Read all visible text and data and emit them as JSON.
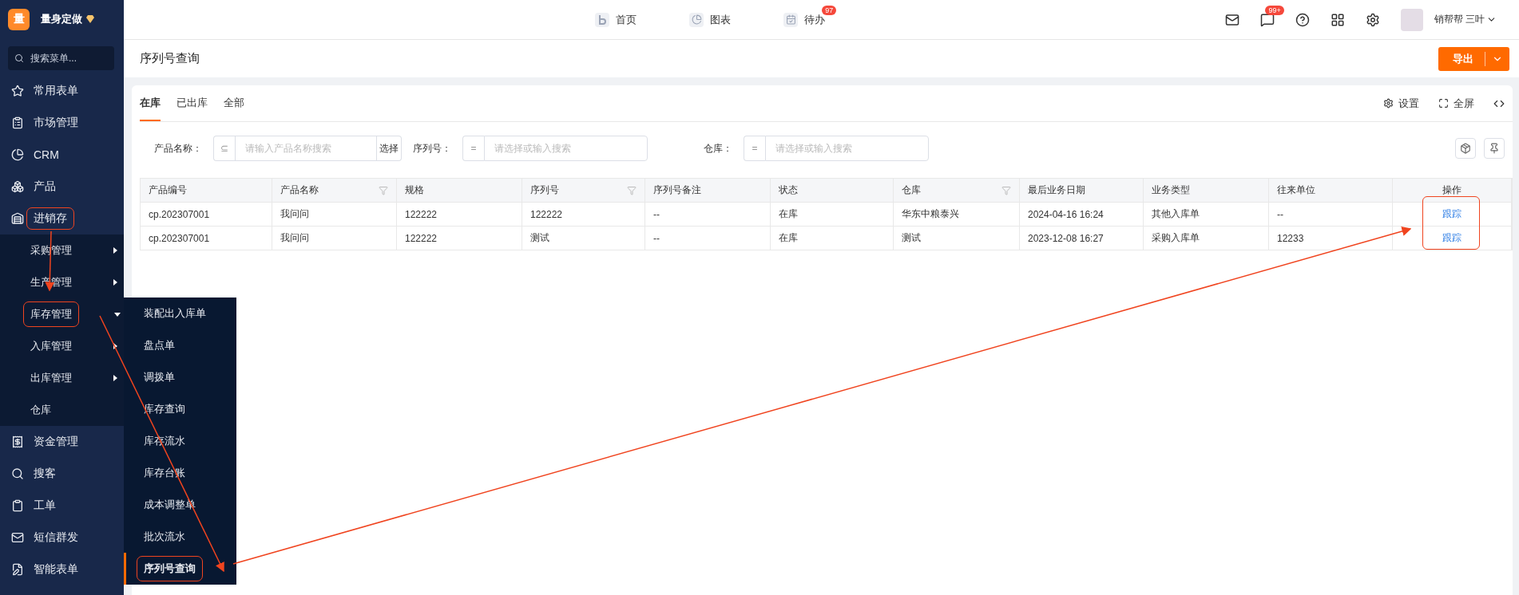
{
  "brand": {
    "logo": "量",
    "name": "量身定做"
  },
  "sidebar": {
    "search_placeholder": "搜索菜单...",
    "items": [
      {
        "label": "常用表单",
        "annotated": false
      },
      {
        "label": "市场管理",
        "annotated": false
      },
      {
        "label": "CRM",
        "annotated": false
      },
      {
        "label": "产品",
        "annotated": false
      },
      {
        "label": "进销存",
        "annotated": true,
        "expanded": true,
        "children": [
          {
            "label": "采购管理",
            "has_submenu": true,
            "annotated": false
          },
          {
            "label": "生产管理",
            "has_submenu": true,
            "annotated": false
          },
          {
            "label": "库存管理",
            "has_submenu": true,
            "expanded": true,
            "annotated": true,
            "children": [
              {
                "label": "装配出入库单",
                "selected": false,
                "annotated": false
              },
              {
                "label": "盘点单",
                "selected": false,
                "annotated": false
              },
              {
                "label": "调拨单",
                "selected": false,
                "annotated": false
              },
              {
                "label": "库存查询",
                "selected": false,
                "annotated": false
              },
              {
                "label": "库存流水",
                "selected": false,
                "annotated": false
              },
              {
                "label": "库存台账",
                "selected": false,
                "annotated": false
              },
              {
                "label": "成本调整单",
                "selected": false,
                "annotated": false
              },
              {
                "label": "批次流水",
                "selected": false,
                "annotated": false
              },
              {
                "label": "序列号查询",
                "selected": true,
                "annotated": true
              }
            ]
          },
          {
            "label": "入库管理",
            "has_submenu": true,
            "annotated": false
          },
          {
            "label": "出库管理",
            "has_submenu": true,
            "annotated": false
          },
          {
            "label": "仓库",
            "has_submenu": false,
            "annotated": false
          }
        ]
      },
      {
        "label": "资金管理",
        "annotated": false
      },
      {
        "label": "搜客",
        "annotated": false
      },
      {
        "label": "工单",
        "annotated": false
      },
      {
        "label": "短信群发",
        "annotated": false
      },
      {
        "label": "智能表单",
        "annotated": false
      }
    ]
  },
  "top_nav": {
    "links": [
      {
        "label": "首页"
      },
      {
        "label": "图表"
      },
      {
        "label": "待办",
        "badge": "97"
      }
    ],
    "message_badge": "99+",
    "user": "销帮帮 三叶"
  },
  "page": {
    "title": "序列号查询",
    "export_button": "导出"
  },
  "tabs": [
    {
      "label": "在库",
      "selected": true
    },
    {
      "label": "已出库",
      "selected": false
    },
    {
      "label": "全部",
      "selected": false
    }
  ],
  "tools": [
    {
      "label": "设置"
    },
    {
      "label": "全屏"
    }
  ],
  "filters": [
    {
      "label": "产品名称：",
      "operator": "⊆",
      "placeholder": "请输入产品名称搜索",
      "action": "选择"
    },
    {
      "label": "序列号：",
      "operator": "=",
      "placeholder": "请选择或输入搜索"
    },
    {
      "label": "仓库：",
      "operator": "=",
      "placeholder": "请选择或输入搜索"
    }
  ],
  "table": {
    "columns": [
      {
        "label": "产品编号",
        "filter": false
      },
      {
        "label": "产品名称",
        "filter": true
      },
      {
        "label": "规格",
        "filter": false
      },
      {
        "label": "序列号",
        "filter": true
      },
      {
        "label": "序列号备注",
        "filter": false
      },
      {
        "label": "状态",
        "filter": false
      },
      {
        "label": "仓库",
        "filter": true
      },
      {
        "label": "最后业务日期",
        "filter": false
      },
      {
        "label": "业务类型",
        "filter": false
      },
      {
        "label": "往来单位",
        "filter": false
      },
      {
        "label": "操作",
        "filter": false
      }
    ],
    "rows": [
      {
        "cells": [
          "cp.202307001",
          "我问问",
          "122222",
          "122222",
          "--",
          "在库",
          "华东中粮泰兴",
          "2024-04-16 16:24",
          "其他入库单",
          "--"
        ],
        "action": "跟踪"
      },
      {
        "cells": [
          "cp.202307001",
          "我问问",
          "122222",
          "测试",
          "--",
          "在库",
          "测试",
          "2023-12-08 16:27",
          "采购入库单",
          "12233"
        ],
        "action": "跟踪"
      }
    ],
    "actions_annotated": true
  }
}
